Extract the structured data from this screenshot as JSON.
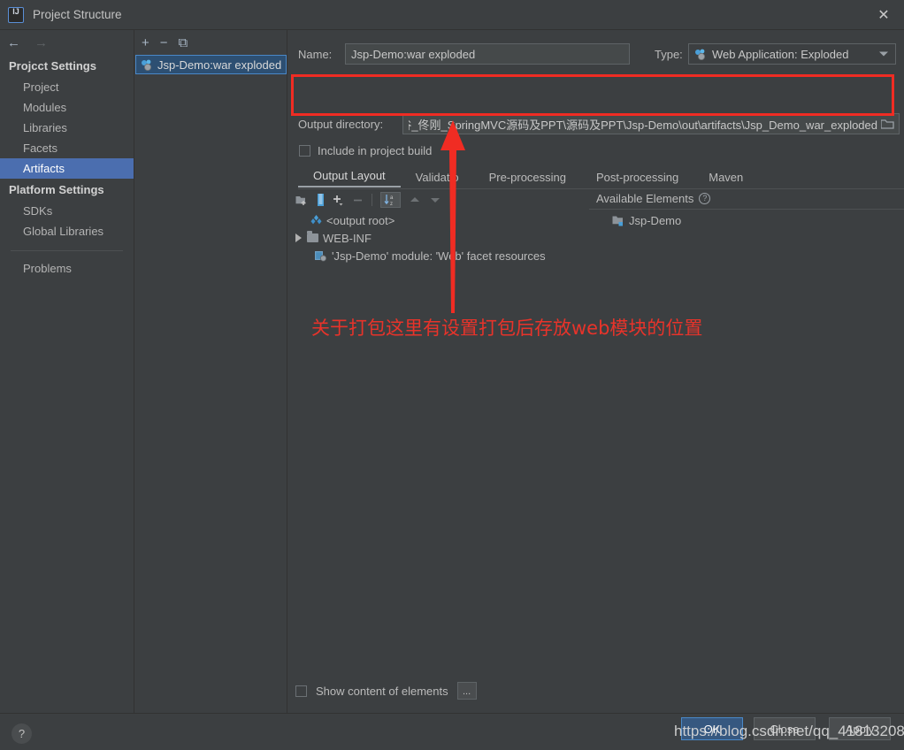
{
  "window": {
    "title": "Project Structure",
    "app_icon": "intellij-idea-icon",
    "close_label": "✕"
  },
  "sidebar": {
    "back_icon": "←",
    "forward_icon": "→",
    "groups": [
      {
        "label": "Projcct Settings",
        "items": [
          {
            "label": "Project",
            "selected": false
          },
          {
            "label": "Modules",
            "selected": false
          },
          {
            "label": "Libraries",
            "selected": false
          },
          {
            "label": "Facets",
            "selected": false
          },
          {
            "label": "Artifacts",
            "selected": true
          }
        ]
      },
      {
        "label": "Platform Settings",
        "items": [
          {
            "label": "SDKs",
            "selected": false
          },
          {
            "label": "Global Libraries",
            "selected": false
          }
        ]
      }
    ],
    "extra": {
      "label": "Problems"
    }
  },
  "artifacts_panel": {
    "toolbar": {
      "add_label": "+",
      "remove_label": "−",
      "copy_label": "⧉"
    },
    "items": [
      {
        "label": "Jsp-Demo:war exploded",
        "icon": "artifact-icon",
        "selected": true
      }
    ]
  },
  "detail": {
    "name_label": "Name:",
    "name_value": "Jsp-Demo:war exploded",
    "type_label": "Type:",
    "type_value": "Web Application: Exploded",
    "type_icon": "artifact-icon",
    "output_dir_label": "Output directory:",
    "output_dir_value": "硅谷_佟刚_SpringMVC源码及PPT\\源码及PPT\\Jsp-Demo\\out\\artifacts\\Jsp_Demo_war_exploded",
    "browse_icon": "folder-browse-icon",
    "include_label": "Include in project build",
    "include_checked": false,
    "tabs": [
      {
        "label": "Output Layout",
        "active": true
      },
      {
        "label": "Validatio",
        "active": false
      },
      {
        "label": "Pre-processing",
        "active": false
      },
      {
        "label": "Post-processing",
        "active": false
      },
      {
        "label": "Maven",
        "active": false
      }
    ],
    "layout_toolbar": [
      {
        "icon": "add-directory-icon",
        "enabled": true
      },
      {
        "icon": "add-archive-icon",
        "enabled": true
      },
      {
        "icon": "add-copy-icon",
        "enabled": true
      },
      {
        "icon": "remove-icon",
        "enabled": false
      },
      {
        "icon": "sort-alphabetically-icon",
        "enabled": true,
        "selected": true
      },
      {
        "icon": "move-up-icon",
        "enabled": false
      },
      {
        "icon": "move-down-icon",
        "enabled": false
      }
    ],
    "output_tree": [
      {
        "label": "<output root>",
        "icon": "artifact-root-icon",
        "depth": 0,
        "expandable": false
      },
      {
        "label": "WEB-INF",
        "icon": "folder-icon",
        "depth": 0,
        "expandable": true
      },
      {
        "label": "'Jsp-Demo' module: 'Web' facet resources",
        "icon": "module-facet-icon",
        "depth": 1,
        "expandable": false
      }
    ],
    "available_elements_label": "Available Elements",
    "available_help_icon": "help-icon",
    "available_tree": [
      {
        "label": "Jsp-Demo",
        "icon": "module-icon"
      }
    ],
    "show_content_label": "Show content of elements",
    "show_content_checked": false,
    "more_button_label": "..."
  },
  "footer": {
    "help_icon": "?",
    "buttons": [
      {
        "label": "OK",
        "primary": true
      },
      {
        "label": "Close",
        "primary": false
      },
      {
        "label": "Apply",
        "primary": false
      }
    ]
  },
  "annotations": {
    "note_text": "关于打包这里有设置打包后存放web模块的位置",
    "note_color": "#e8332a",
    "highlight_color": "#f02c23",
    "arrow_icon": "red-up-arrow"
  },
  "watermark": {
    "text": "https://blog.csdn.net/qq_41813208"
  }
}
